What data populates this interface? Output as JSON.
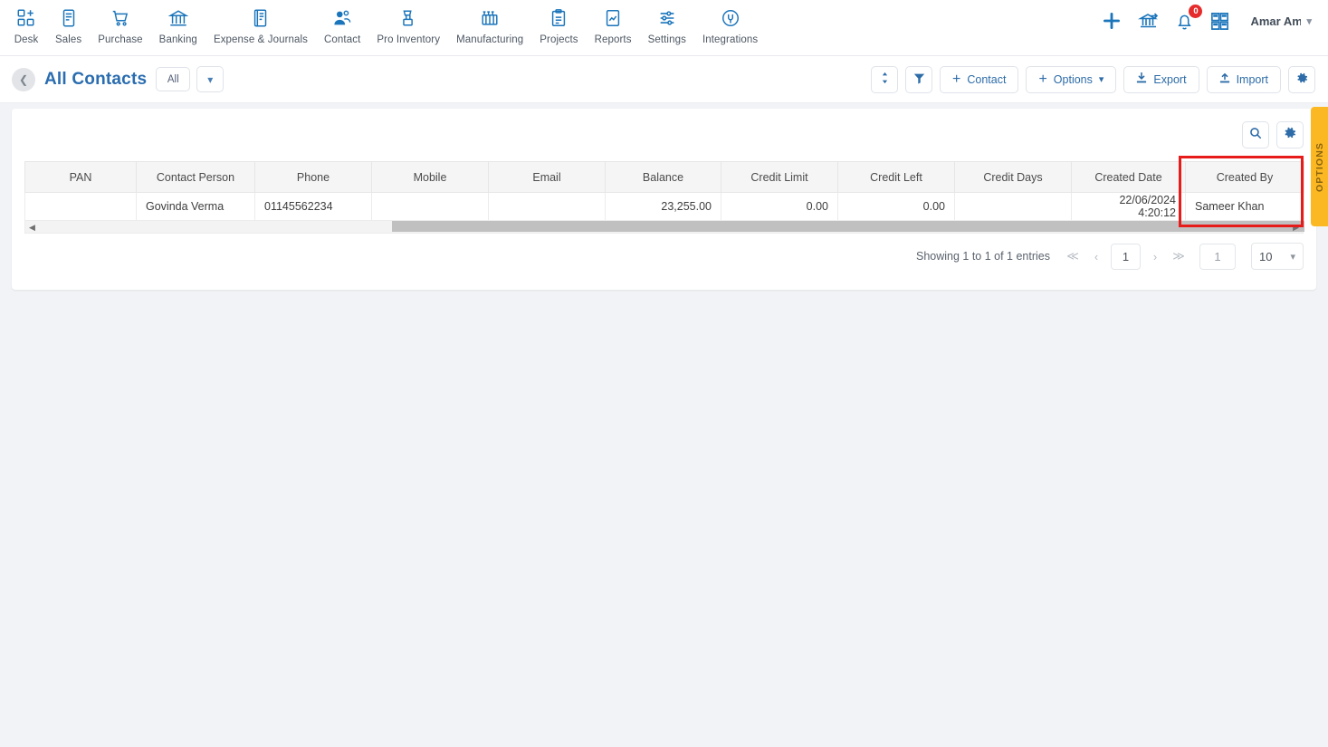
{
  "nav": {
    "items": [
      {
        "label": "Desk",
        "icon": "desk-grid-plus-icon"
      },
      {
        "label": "Sales",
        "icon": "sales-invoice-icon"
      },
      {
        "label": "Purchase",
        "icon": "purchase-cart-icon"
      },
      {
        "label": "Banking",
        "icon": "banking-bank-icon"
      },
      {
        "label": "Expense & Journals",
        "icon": "expense-book-icon"
      },
      {
        "label": "Contact",
        "icon": "contact-people-icon"
      },
      {
        "label": "Pro Inventory",
        "icon": "inventory-box-icon"
      },
      {
        "label": "Manufacturing",
        "icon": "manufacturing-factory-icon"
      },
      {
        "label": "Projects",
        "icon": "projects-clipboard-icon"
      },
      {
        "label": "Reports",
        "icon": "reports-chart-icon"
      },
      {
        "label": "Settings",
        "icon": "settings-sliders-icon"
      },
      {
        "label": "Integrations",
        "icon": "integrations-plug-icon"
      }
    ],
    "right": {
      "add_icon": "plus-icon",
      "bank_icon": "bank-transfer-icon",
      "bell_icon": "bell-icon",
      "notification_count": "0",
      "apps_icon": "apps-grid-icon",
      "user_name": "Amar Am",
      "user_caret_icon": "chevron-down-icon"
    }
  },
  "subheader": {
    "back_icon": "chevron-left-icon",
    "title": "All Contacts",
    "filter_chip": "All",
    "chip_caret_icon": "chevron-down-icon",
    "toolbar": {
      "sort_icon": "sort-updown-icon",
      "filter_icon": "funnel-icon",
      "contact_label": "Contact",
      "options_label": "Options",
      "options_caret_icon": "chevron-down-icon",
      "export_label": "Export",
      "export_icon": "download-icon",
      "import_label": "Import",
      "import_icon": "upload-icon",
      "settings_icon": "gear-icon"
    }
  },
  "card": {
    "search_icon": "search-icon",
    "settings_icon": "gear-icon"
  },
  "table": {
    "columns": [
      "PAN",
      "Contact Person",
      "Phone",
      "Mobile",
      "Email",
      "Balance",
      "Credit Limit",
      "Credit Left",
      "Credit Days",
      "Created Date",
      "Created By"
    ],
    "rows": [
      {
        "pan": "",
        "contact_person": "Govinda Verma",
        "phone": "01145562234",
        "mobile": "",
        "email": "",
        "balance": "23,255.00",
        "credit_limit": "0.00",
        "credit_left": "0.00",
        "credit_days": "",
        "created_date": "22/06/2024 4:20:12",
        "created_by": "Sameer Khan"
      }
    ],
    "scrollbar": {
      "left_arrow_icon": "triangle-left-icon",
      "right_arrow_icon": "triangle-right-icon"
    }
  },
  "pagination": {
    "info": "Showing 1 to 1 of 1 entries",
    "first_icon": "double-chevron-left-icon",
    "prev_icon": "chevron-left-icon",
    "current_page": "1",
    "next_icon": "chevron-right-icon",
    "last_icon": "double-chevron-right-icon",
    "jump_value": "1",
    "page_size": "10",
    "page_size_caret_icon": "chevron-down-icon"
  },
  "side_panel": {
    "label": "OPTIONS",
    "color": "#fcb823"
  },
  "annotation": {
    "highlight_color": "#e81b1b",
    "highlight_target": "Created By"
  },
  "colors": {
    "accent": "#1b75bb",
    "title": "#2a6db0",
    "badge": "#e52b2b"
  }
}
